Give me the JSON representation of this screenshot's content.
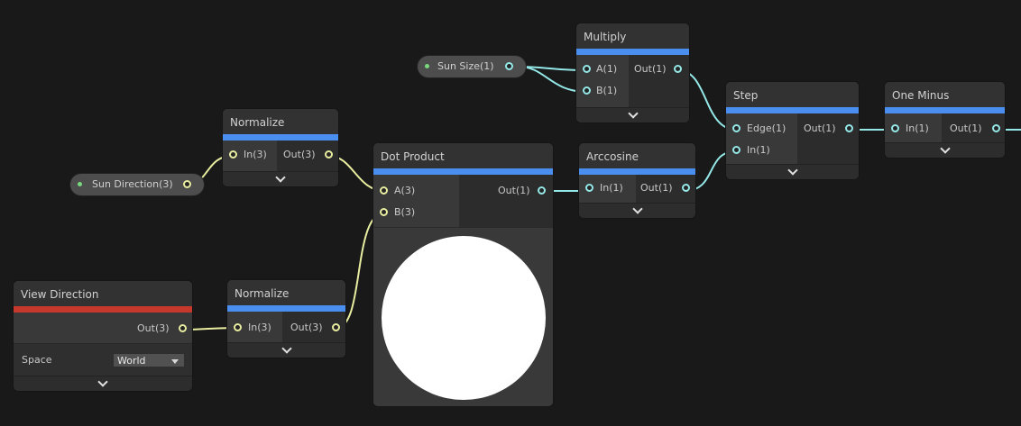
{
  "properties": {
    "sun_size": "Sun Size(1)",
    "sun_direction": "Sun Direction(3)"
  },
  "nodes": {
    "multiply": {
      "title": "Multiply",
      "in_a": "A(1)",
      "in_b": "B(1)",
      "out": "Out(1)"
    },
    "normalize_top": {
      "title": "Normalize",
      "in": "In(3)",
      "out": "Out(3)"
    },
    "dot_product": {
      "title": "Dot Product",
      "in_a": "A(3)",
      "in_b": "B(3)",
      "out": "Out(1)"
    },
    "arccosine": {
      "title": "Arccosine",
      "in": "In(1)",
      "out": "Out(1)"
    },
    "step": {
      "title": "Step",
      "in_edge": "Edge(1)",
      "in_in": "In(1)",
      "out": "Out(1)"
    },
    "one_minus": {
      "title": "One Minus",
      "in": "In(1)",
      "out": "Out(1)"
    },
    "view_direction": {
      "title": "View Direction",
      "out": "Out(3)",
      "space_label": "Space",
      "space_value": "World"
    },
    "normalize_bottom": {
      "title": "Normalize",
      "in": "In(3)",
      "out": "Out(3)"
    }
  },
  "colors": {
    "vector1_port": "#95e8e8",
    "vector3_port": "#e8eda0",
    "node_header_bar": "#4a8ef0",
    "input_node_header_bar": "#c6382c",
    "property_dot": "#79d97e"
  }
}
